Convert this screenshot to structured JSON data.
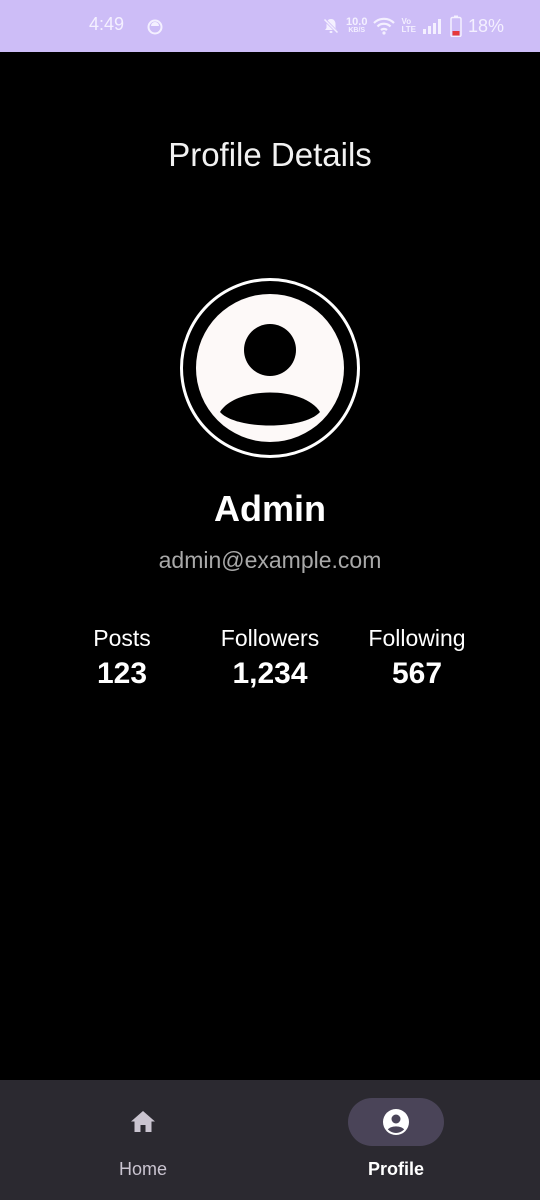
{
  "status_bar": {
    "time": "4:49",
    "net_speed_value": "10.0",
    "net_speed_unit": "KB/S",
    "volte_top": "Vo",
    "volte_bottom": "LTE",
    "battery_percent": "18%",
    "background_color": "#cdbdf7",
    "icons": [
      "sync-icon",
      "mute-icon",
      "wifi-icon",
      "signal-icon",
      "battery-icon"
    ]
  },
  "page": {
    "title": "Profile Details"
  },
  "profile": {
    "avatar_icon": "person-avatar-icon",
    "name": "Admin",
    "email": "admin@example.com"
  },
  "stats": [
    {
      "label": "Posts",
      "value": "123"
    },
    {
      "label": "Followers",
      "value": "1,234"
    },
    {
      "label": "Following",
      "value": "567"
    }
  ],
  "bottom_nav": {
    "background_color": "#2b2930",
    "indicator_color": "#4a4458",
    "items": [
      {
        "label": "Home",
        "icon": "home-icon",
        "selected": false
      },
      {
        "label": "Profile",
        "icon": "account-circle-icon",
        "selected": true
      }
    ]
  }
}
